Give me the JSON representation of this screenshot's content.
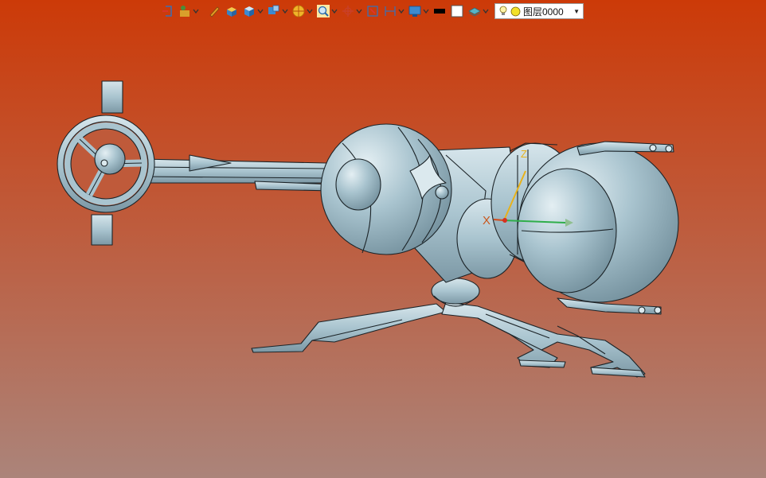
{
  "colors": {
    "background_top": "#cc3a08",
    "background_mid": "#bf5a3a",
    "background_bottom": "#ab847a",
    "model_fill": "#a9c4cf",
    "model_highlight": "#dbe9ee",
    "model_shadow": "#7c98a5",
    "model_outline": "#1c2428",
    "axis_x": "#d34a1a",
    "axis_y": "#2fae4a",
    "axis_z": "#e8b21a"
  },
  "toolbar": {
    "items": [
      {
        "name": "exit-sketch-icon",
        "dropdown": false
      },
      {
        "name": "selection-filter-icon",
        "dropdown": true
      },
      {
        "name": "pen-icon",
        "dropdown": false
      },
      {
        "name": "view-box-icon",
        "dropdown": false
      },
      {
        "name": "render-style-icon",
        "dropdown": true
      },
      {
        "name": "view-orient-icon",
        "dropdown": true
      },
      {
        "name": "appearance-icon",
        "dropdown": true
      },
      {
        "name": "zoom-icon",
        "dropdown": true
      },
      {
        "name": "snap-icon",
        "dropdown": true
      },
      {
        "name": "section-icon",
        "dropdown": false
      },
      {
        "name": "dimension-icon",
        "dropdown": true
      },
      {
        "name": "display-icon",
        "dropdown": true
      },
      {
        "name": "color-black-icon",
        "dropdown": false
      },
      {
        "name": "color-white-icon",
        "dropdown": false
      },
      {
        "name": "layer-state-icon",
        "dropdown": true
      }
    ],
    "layer": {
      "label": "图层0000",
      "icon": "bulb-icon"
    }
  },
  "triad": {
    "x_label": "X",
    "z_label": "Z"
  }
}
